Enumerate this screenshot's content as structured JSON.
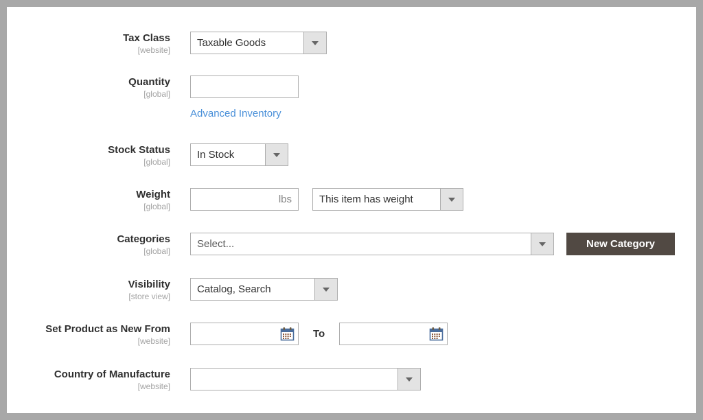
{
  "page": {
    "frame_color": "#a8a8a8",
    "background": "#ffffff",
    "accent_link_color": "#4a90d9",
    "button_color": "#514943"
  },
  "form": {
    "rows": [
      {
        "id": "tax-class",
        "label": "Tax Class",
        "scope": "[website]",
        "control": "select",
        "value": "Taxable Goods"
      },
      {
        "id": "quantity",
        "label": "Quantity",
        "scope": "[global]",
        "control": "text",
        "value": "",
        "link": "Advanced Inventory"
      },
      {
        "id": "stock-status",
        "label": "Stock Status",
        "scope": "[global]",
        "control": "select",
        "value": "In Stock"
      },
      {
        "id": "weight",
        "label": "Weight",
        "scope": "[global]",
        "control": "text-unit-select",
        "value": "",
        "unit": "lbs",
        "select_value": "This item has weight"
      },
      {
        "id": "categories",
        "label": "Categories",
        "scope": "[global]",
        "control": "select-button",
        "value": "Select...",
        "button": "New Category"
      },
      {
        "id": "visibility",
        "label": "Visibility",
        "scope": "[store view]",
        "control": "select",
        "value": "Catalog, Search"
      },
      {
        "id": "set-product-as-new-from",
        "label": "Set Product as New From",
        "scope": "[website]",
        "control": "date-range",
        "value_from": "",
        "separator": "To",
        "value_to": ""
      },
      {
        "id": "country-of-manufacture",
        "label": "Country of Manufacture",
        "scope": "[website]",
        "control": "select",
        "value": ""
      }
    ]
  },
  "icons": {
    "calendar": "calendar-icon",
    "caret": "chevron-down-icon"
  }
}
